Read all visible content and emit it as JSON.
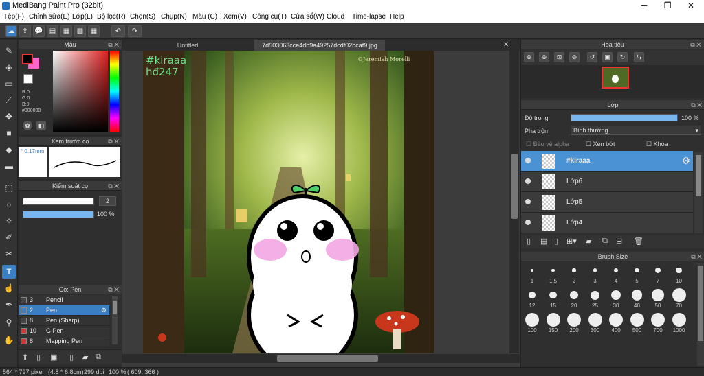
{
  "window": {
    "title": "MediBang Paint Pro (32bit)",
    "minimize": "─",
    "maximize": "❐",
    "close": "✕"
  },
  "menu": [
    "Tệp(F)",
    "Chỉnh sửa(E)",
    "Lớp(L)",
    "Bộ lọc(R)",
    "Chọn(S)",
    "Chụp(N)",
    "Màu (C)",
    "Xem(V)",
    "Công cụ(T)",
    "Cửa sổ(W)",
    "Cloud",
    "Time-lapse",
    "Help"
  ],
  "toolbar": {
    "icons": [
      "cloud-icon",
      "share-icon",
      "comment-icon",
      "panel-icon",
      "page-icon",
      "grid-icon",
      "tile-icon",
      "undo-icon",
      "redo-icon"
    ],
    "glyphs": [
      "☁",
      "⇪",
      "💬",
      "▤",
      "▦",
      "▥",
      "▦",
      "↶",
      "↷"
    ]
  },
  "colorPanel": {
    "title": "Màu",
    "r": "R:0",
    "g": "G:0",
    "b": "B:0",
    "hex": "#000000",
    "fg": "#000000",
    "bg": "#ff66cc"
  },
  "brushPreview": {
    "title": "Xem trước cọ",
    "size": "° 0.17mm"
  },
  "brushControl": {
    "title": "Kiểm soát cọ",
    "size": "2",
    "opacity": "100 %",
    "opacityLevel": 1.0
  },
  "brushList": {
    "title": "Cọ: Pen",
    "items": [
      {
        "num": "3",
        "label": "Pencil",
        "color": "#444444",
        "selected": false
      },
      {
        "num": "2",
        "label": "Pen",
        "color": "#3a7fc4",
        "selected": true
      },
      {
        "num": "8",
        "label": "Pen (Sharp)",
        "color": "#444444",
        "selected": false
      },
      {
        "num": "10",
        "label": "G Pen",
        "color": "#e03030",
        "selected": false
      },
      {
        "num": "8",
        "label": "Mapping Pen",
        "color": "#e03030",
        "selected": false
      }
    ]
  },
  "tabs": {
    "first": "Untitled",
    "second": "7d503063cce4db9a49257dcdf02bcaf9.jpg"
  },
  "artwork": {
    "tag": "#kiraaa",
    "tag2": "hđ247",
    "credit": "©Jeremiah Morelli"
  },
  "navigator": {
    "title": "Hoa tiêu"
  },
  "layerPanel": {
    "title": "Lớp",
    "opacityLabel": "Độ trong",
    "opacityValue": "100 %",
    "opacityLevel": 1.0,
    "blendLabel": "Pha trộn",
    "blendValue": "Bình thường",
    "protectAlpha": "Bảo vệ alpha",
    "clip": "Xén bớt",
    "lock": "Khóa",
    "layers": [
      {
        "name": "#kiraaa",
        "selected": true
      },
      {
        "name": "Lớp6",
        "selected": false
      },
      {
        "name": "Lớp5",
        "selected": false
      },
      {
        "name": "Lớp4",
        "selected": false
      }
    ]
  },
  "brushSize": {
    "title": "Brush Size",
    "sizes": [
      "1",
      "1.5",
      "2",
      "3",
      "4",
      "5",
      "7",
      "10",
      "12",
      "15",
      "20",
      "25",
      "30",
      "40",
      "50",
      "70",
      "100",
      "150",
      "200",
      "300",
      "400",
      "500",
      "700",
      "1000"
    ]
  },
  "status": {
    "size": "564 * 797 pixel",
    "cm": "(4.8 * 6.8cm)",
    "dpi": "299 dpi",
    "zoom": "100 %",
    "coords": "( 609, 366 )"
  }
}
